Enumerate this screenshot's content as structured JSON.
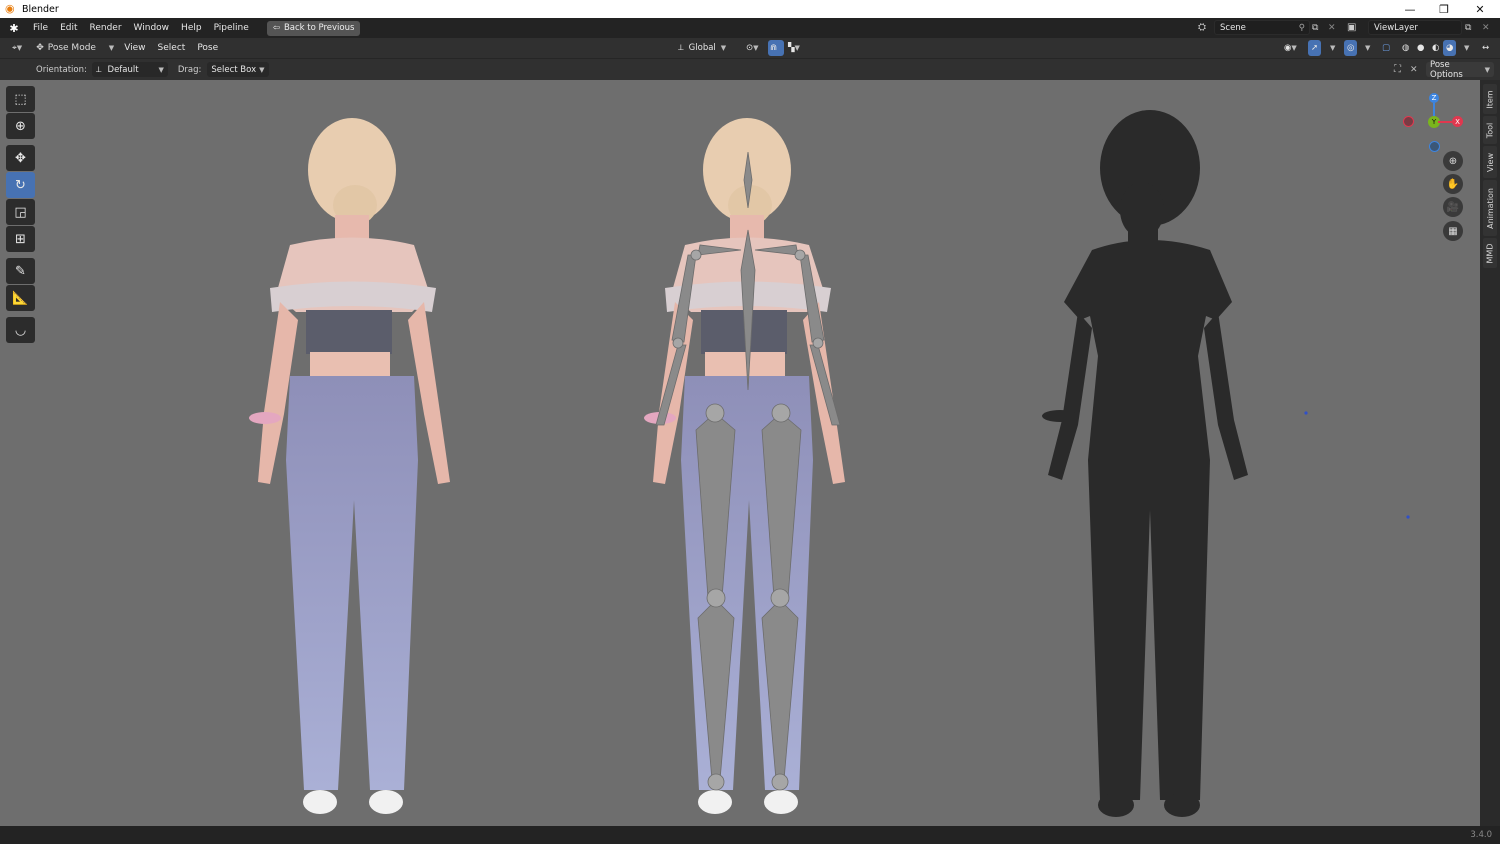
{
  "window": {
    "title": "Blender",
    "controls": [
      "—",
      "❐",
      "✕"
    ]
  },
  "menu": {
    "items": [
      "File",
      "Edit",
      "Render",
      "Window",
      "Help",
      "Pipeline"
    ],
    "back_button": "Back to Previous",
    "scene": "Scene",
    "view_layer": "ViewLayer"
  },
  "header": {
    "mode": "Pose Mode",
    "items": [
      "View",
      "Select",
      "Pose"
    ],
    "transform_orientation": "Global"
  },
  "tool_settings": {
    "orientation_label": "Orientation:",
    "orientation_value": "Default",
    "drag_label": "Drag:",
    "drag_value": "Select Box",
    "pose_options": "Pose Options"
  },
  "gizmo": {
    "z": "Z",
    "y": "Y",
    "x": "X"
  },
  "sidebar_tabs": [
    "Item",
    "Tool",
    "View",
    "Animation",
    "MMD"
  ],
  "status": {
    "version": "3.4.0"
  },
  "colors": {
    "accent": "#4772b3",
    "viewport_bg": "#6e6e6e",
    "x_axis": "#e0384f",
    "y_axis": "#7ab51d",
    "z_axis": "#3d85e0"
  }
}
